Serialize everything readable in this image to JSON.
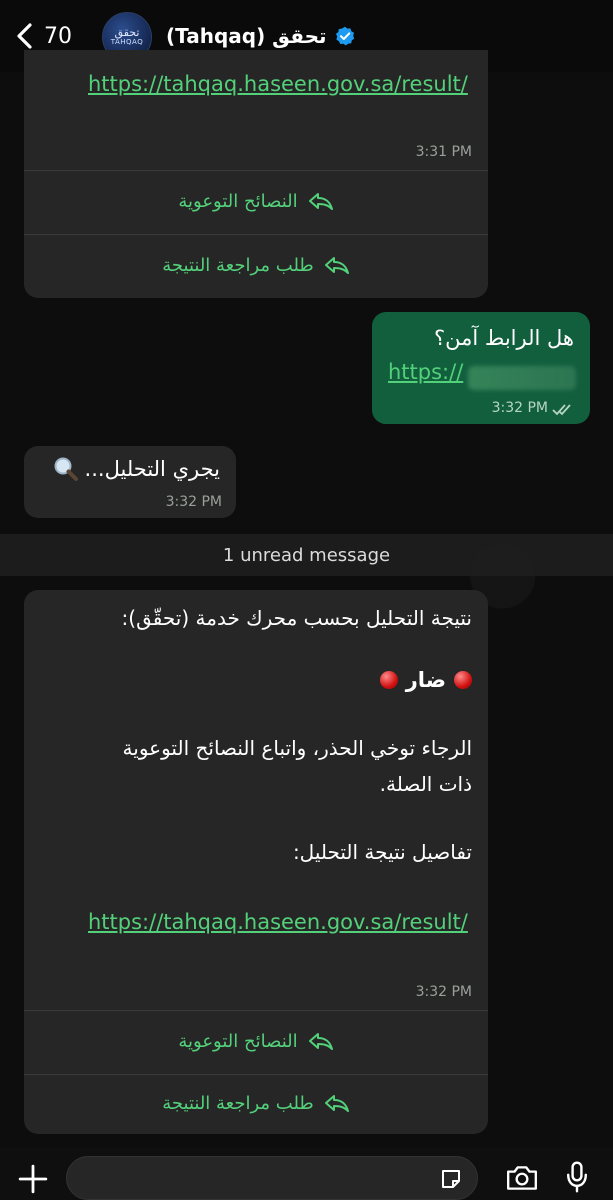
{
  "header": {
    "back_count": "70",
    "contact_name": "(Tahqaq) تحقق",
    "avatar_text_ar": "تحقق",
    "avatar_text_en": "TAHQAQ"
  },
  "msg1": {
    "link": "https://tahqaq.haseen.gov.sa/result/",
    "time": "3:31 PM",
    "action1": "النصائح التوعوية",
    "action2": "طلب مراجعة النتيجة"
  },
  "msg2": {
    "text": "هل الرابط آمن؟",
    "link": "https://",
    "time": "3:32 PM"
  },
  "msg3": {
    "text": "يجري التحليل...",
    "time": "3:32 PM"
  },
  "unread_label": "1 unread message",
  "msg4": {
    "line1": "نتيجة التحليل بحسب محرك خدمة (تحقّق):",
    "verdict": "ضار",
    "warning_line1": "الرجاء توخي الحذر، واتباع النصائح التوعوية",
    "warning_line2": "ذات الصلة.",
    "details_label": "تفاصيل نتيجة التحليل:",
    "link": "https://tahqaq.haseen.gov.sa/result/",
    "time": "3:32 PM",
    "action1": "النصائح التوعوية",
    "action2": "طلب مراجعة النتيجة"
  },
  "icons": {
    "back": "chevron-left-icon",
    "verified": "verified-badge-icon",
    "reply": "reply-arrow-icon",
    "read": "double-check-icon",
    "magnifier": "magnifier-icon",
    "plus": "plus-icon",
    "sticker": "sticker-icon",
    "camera": "camera-icon",
    "mic": "microphone-icon"
  },
  "colors": {
    "accent_green": "#53d17a",
    "outgoing_bubble": "#125f3e",
    "incoming_bubble": "#262626",
    "verified_blue": "#1d9bf0",
    "danger_red": "#d11212"
  }
}
